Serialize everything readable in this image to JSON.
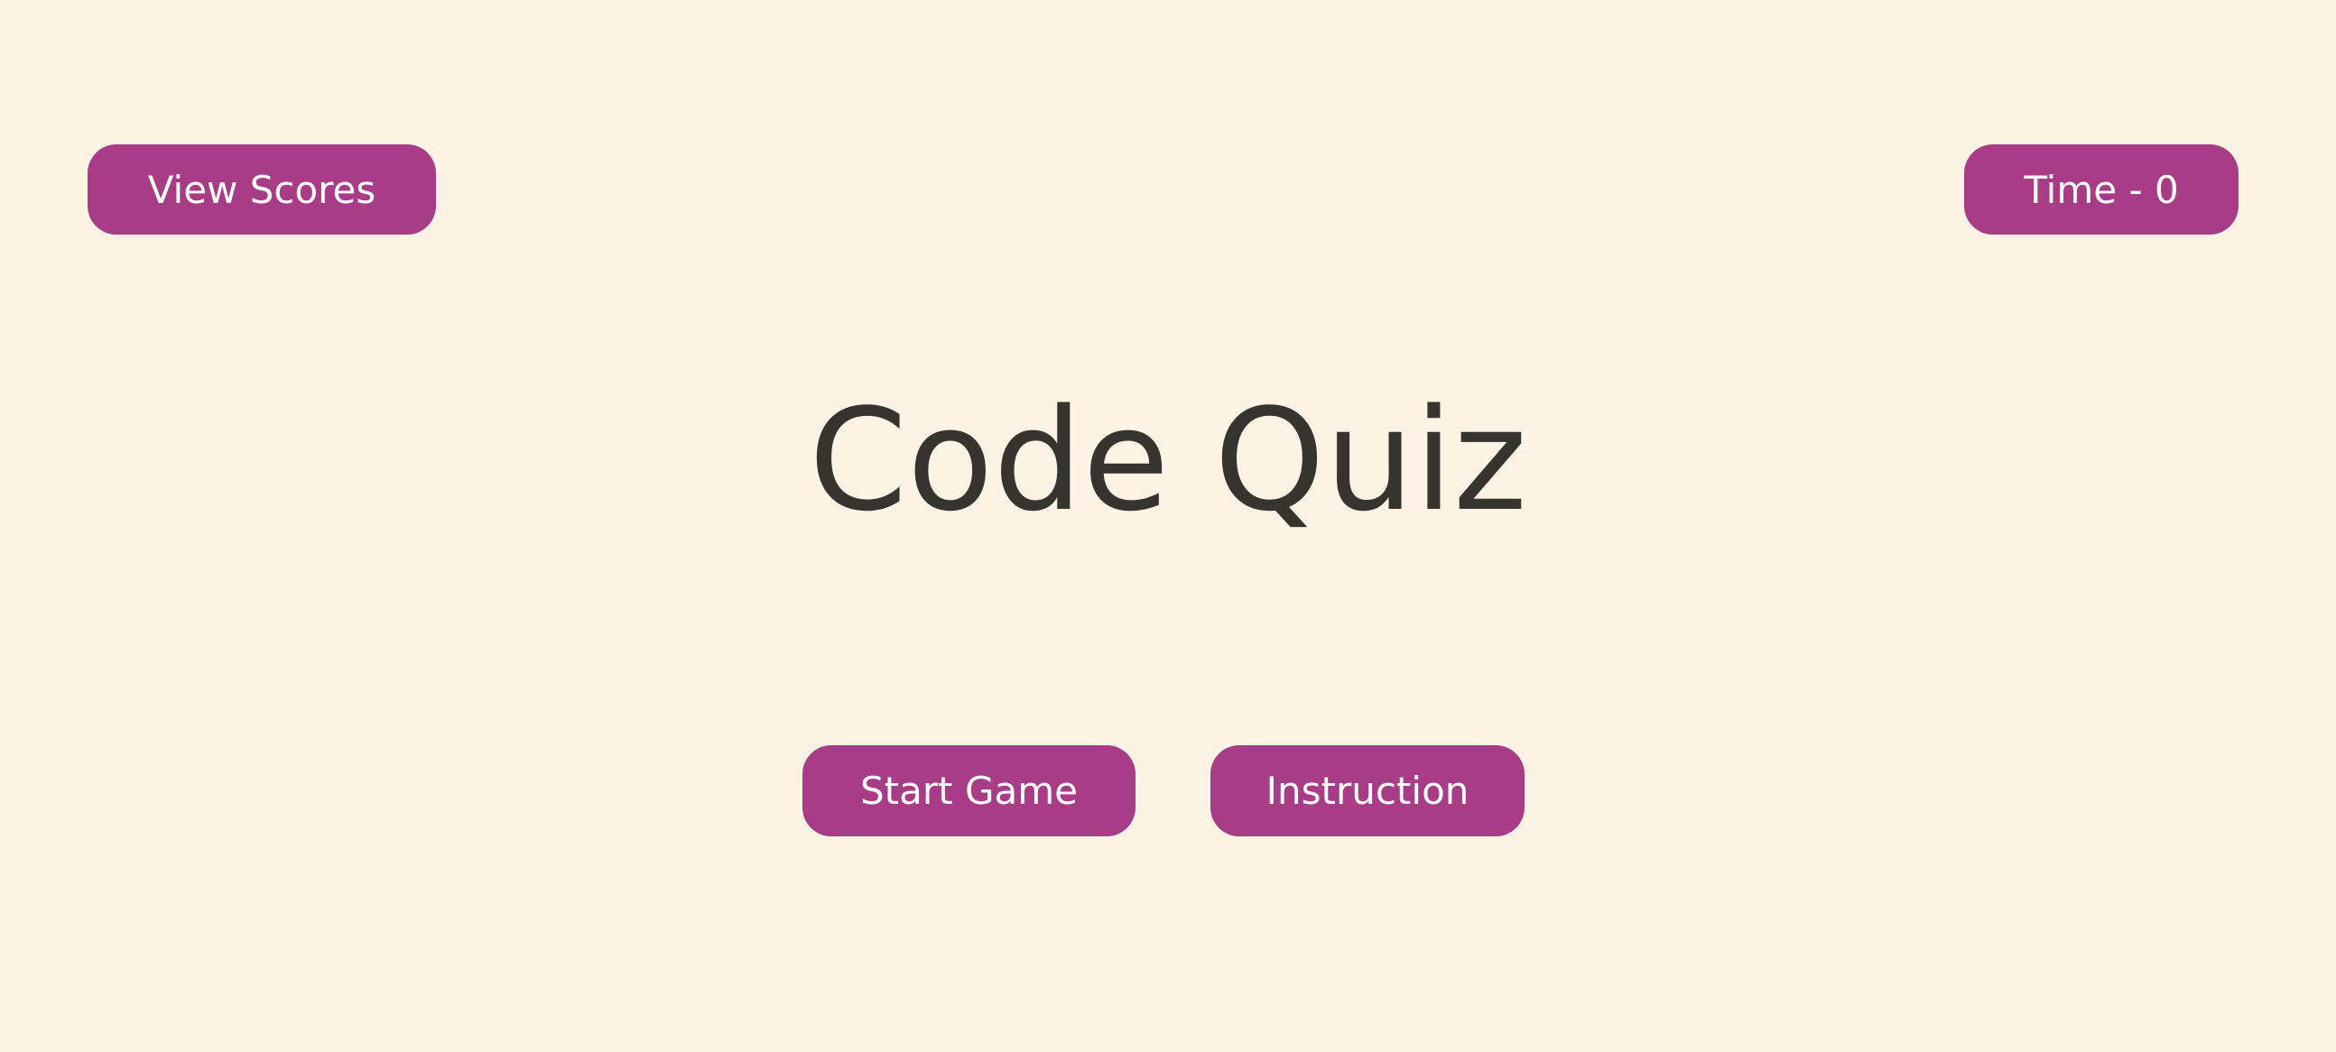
{
  "header": {
    "view_scores_label": "View Scores",
    "time_label": "Time - 0"
  },
  "main": {
    "title": "Code Quiz",
    "start_label": "Start Game",
    "instruction_label": "Instruction"
  },
  "colors": {
    "background": "#fdf3e5",
    "button": "#a83c86",
    "button_text": "#ffffff",
    "title_text": "#36342f"
  }
}
